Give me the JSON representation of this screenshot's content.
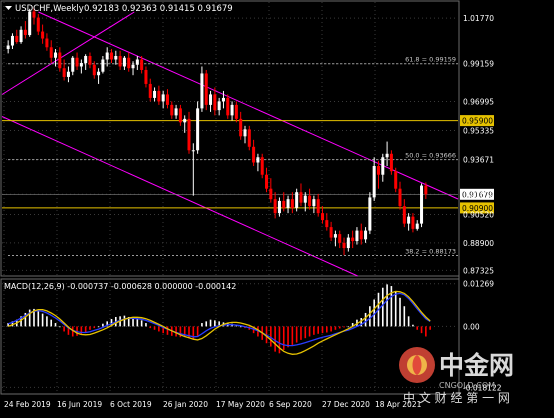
{
  "header": {
    "symbol": "USDCHF,Weekly",
    "ohlc": "0.92183 0.92363 0.91415 0.91679"
  },
  "colors": {
    "background": "#000000",
    "grid": "#3a3a3a",
    "bull": "#ffffff",
    "bear": "#ff0000",
    "channel": "#ff00ff",
    "level_line": "#e6c200",
    "fib_line": "#9a9a9a",
    "macd_line": "#e6c200",
    "signal_line": "#2a3cff",
    "hist_pos": "#ffffff",
    "hist_neg": "#ff0000"
  },
  "price_axis": {
    "labels": [
      "1.01770",
      "0.99159",
      "0.96995",
      "0.95335",
      "0.93671",
      "0.91679",
      "0.90520",
      "0.88900",
      "0.87325"
    ],
    "ylim": [
      0.87,
      1.0275
    ]
  },
  "levels": [
    {
      "name": "level-0.95900",
      "value": 0.959,
      "label": "0.95900",
      "type": "horizontal"
    },
    {
      "name": "level-0.90900",
      "value": 0.909,
      "label": "0.90900",
      "type": "horizontal"
    },
    {
      "name": "current-price",
      "value": 0.91679,
      "label": "0.91679",
      "type": "price"
    }
  ],
  "fib": [
    {
      "label": "61.8 = 0.99159",
      "value": 0.99159
    },
    {
      "label": "50.0 = 0.93666",
      "value": 0.93666
    },
    {
      "label": "38.2 = 0.88173",
      "value": 0.88173
    }
  ],
  "time_axis": {
    "labels": [
      "24 Feb 2019",
      "16 Jun 2019",
      "6 Oct 2019",
      "26 Jan 2020",
      "17 May 2020",
      "6 Sep 2020",
      "27 Dec 2020",
      "18 Apr 2021"
    ]
  },
  "macd": {
    "title": "MACD(12,26,9) -0.000737 -0.000628 0.000000 -0.000142",
    "labels": [
      "0.01269",
      "0.00",
      "-0.018122"
    ],
    "ylim": [
      -0.0195,
      0.0135
    ]
  },
  "chart_data": {
    "type": "candlestick",
    "title": "USDCHF,Weekly",
    "candles": [
      [
        1.0,
        1.005,
        0.9975,
        1.002
      ],
      [
        1.002,
        1.009,
        1.0,
        1.0075
      ],
      [
        1.0075,
        1.011,
        1.003,
        1.004
      ],
      [
        1.004,
        1.013,
        1.003,
        1.011
      ],
      [
        1.011,
        1.016,
        1.006,
        1.008
      ],
      [
        1.008,
        1.023,
        1.007,
        1.0215
      ],
      [
        1.0215,
        1.024,
        1.014,
        1.018
      ],
      [
        1.018,
        1.02,
        1.008,
        1.01
      ],
      [
        1.01,
        1.014,
        1.003,
        1.006
      ],
      [
        1.006,
        1.009,
        0.999,
        1.001
      ],
      [
        1.001,
        1.005,
        0.992,
        0.995
      ],
      [
        0.995,
        1.0,
        0.99,
        0.998
      ],
      [
        0.998,
        1.001,
        0.987,
        0.989
      ],
      [
        0.989,
        0.994,
        0.982,
        0.984
      ],
      [
        0.984,
        0.99,
        0.981,
        0.987
      ],
      [
        0.987,
        0.996,
        0.985,
        0.995
      ],
      [
        0.995,
        0.998,
        0.988,
        0.99
      ],
      [
        0.99,
        0.994,
        0.986,
        0.992
      ],
      [
        0.992,
        0.997,
        0.988,
        0.996
      ],
      [
        0.996,
        0.998,
        0.989,
        0.991
      ],
      [
        0.991,
        0.993,
        0.983,
        0.985
      ],
      [
        0.985,
        0.989,
        0.98,
        0.987
      ],
      [
        0.987,
        0.996,
        0.986,
        0.994
      ],
      [
        0.994,
        1.001,
        0.99,
        0.998
      ],
      [
        0.998,
        1.0,
        0.992,
        0.994
      ],
      [
        0.994,
        0.999,
        0.991,
        0.996
      ],
      [
        0.996,
        0.999,
        0.988,
        0.99
      ],
      [
        0.99,
        0.996,
        0.988,
        0.995
      ],
      [
        0.995,
        0.998,
        0.987,
        0.989
      ],
      [
        0.989,
        0.993,
        0.985,
        0.991
      ],
      [
        0.991,
        0.996,
        0.988,
        0.994
      ],
      [
        0.994,
        0.996,
        0.986,
        0.988
      ],
      [
        0.988,
        0.99,
        0.978,
        0.98
      ],
      [
        0.98,
        0.983,
        0.97,
        0.972
      ],
      [
        0.972,
        0.978,
        0.97,
        0.976
      ],
      [
        0.976,
        0.979,
        0.968,
        0.97
      ],
      [
        0.97,
        0.976,
        0.966,
        0.974
      ],
      [
        0.974,
        0.977,
        0.966,
        0.968
      ],
      [
        0.968,
        0.97,
        0.96,
        0.962
      ],
      [
        0.962,
        0.968,
        0.96,
        0.966
      ],
      [
        0.966,
        0.968,
        0.956,
        0.958
      ],
      [
        0.958,
        0.962,
        0.952,
        0.96
      ],
      [
        0.96,
        0.964,
        0.94,
        0.942
      ],
      [
        0.942,
        0.946,
        0.916,
        0.942
      ],
      [
        0.942,
        0.97,
        0.94,
        0.966
      ],
      [
        0.966,
        0.99,
        0.964,
        0.986
      ],
      [
        0.986,
        0.988,
        0.965,
        0.968
      ],
      [
        0.968,
        0.976,
        0.964,
        0.974
      ],
      [
        0.974,
        0.978,
        0.962,
        0.965
      ],
      [
        0.965,
        0.972,
        0.962,
        0.97
      ],
      [
        0.97,
        0.976,
        0.966,
        0.972
      ],
      [
        0.972,
        0.974,
        0.96,
        0.962
      ],
      [
        0.962,
        0.97,
        0.959,
        0.968
      ],
      [
        0.968,
        0.97,
        0.958,
        0.96
      ],
      [
        0.96,
        0.964,
        0.948,
        0.95
      ],
      [
        0.95,
        0.956,
        0.946,
        0.954
      ],
      [
        0.954,
        0.956,
        0.942,
        0.944
      ],
      [
        0.944,
        0.948,
        0.933,
        0.935
      ],
      [
        0.935,
        0.94,
        0.93,
        0.938
      ],
      [
        0.938,
        0.94,
        0.926,
        0.928
      ],
      [
        0.928,
        0.932,
        0.918,
        0.92
      ],
      [
        0.92,
        0.926,
        0.912,
        0.914
      ],
      [
        0.914,
        0.918,
        0.903,
        0.906
      ],
      [
        0.906,
        0.915,
        0.904,
        0.913
      ],
      [
        0.913,
        0.918,
        0.907,
        0.909
      ],
      [
        0.909,
        0.916,
        0.906,
        0.914
      ],
      [
        0.914,
        0.918,
        0.906,
        0.909
      ],
      [
        0.909,
        0.92,
        0.907,
        0.918
      ],
      [
        0.918,
        0.923,
        0.91,
        0.912
      ],
      [
        0.912,
        0.918,
        0.907,
        0.916
      ],
      [
        0.916,
        0.92,
        0.908,
        0.91
      ],
      [
        0.91,
        0.916,
        0.906,
        0.914
      ],
      [
        0.914,
        0.917,
        0.904,
        0.906
      ],
      [
        0.906,
        0.91,
        0.9,
        0.902
      ],
      [
        0.902,
        0.906,
        0.896,
        0.898
      ],
      [
        0.898,
        0.901,
        0.89,
        0.892
      ],
      [
        0.892,
        0.896,
        0.887,
        0.894
      ],
      [
        0.894,
        0.896,
        0.886,
        0.889
      ],
      [
        0.889,
        0.892,
        0.882,
        0.886
      ],
      [
        0.886,
        0.894,
        0.884,
        0.892
      ],
      [
        0.892,
        0.896,
        0.886,
        0.89
      ],
      [
        0.89,
        0.898,
        0.888,
        0.896
      ],
      [
        0.896,
        0.9,
        0.888,
        0.891
      ],
      [
        0.891,
        0.898,
        0.889,
        0.896
      ],
      [
        0.896,
        0.918,
        0.894,
        0.915
      ],
      [
        0.915,
        0.938,
        0.913,
        0.933
      ],
      [
        0.933,
        0.936,
        0.92,
        0.928
      ],
      [
        0.928,
        0.94,
        0.924,
        0.938
      ],
      [
        0.938,
        0.947,
        0.933,
        0.94
      ],
      [
        0.94,
        0.942,
        0.928,
        0.93
      ],
      [
        0.93,
        0.932,
        0.918,
        0.92
      ],
      [
        0.92,
        0.924,
        0.908,
        0.91
      ],
      [
        0.91,
        0.914,
        0.898,
        0.9
      ],
      [
        0.9,
        0.906,
        0.896,
        0.904
      ],
      [
        0.904,
        0.906,
        0.895,
        0.897
      ],
      [
        0.897,
        0.902,
        0.896,
        0.9
      ],
      [
        0.9,
        0.923,
        0.898,
        0.9218
      ],
      [
        0.9218,
        0.9236,
        0.9141,
        0.9168
      ]
    ],
    "macd_hist": [
      0.001,
      0.0015,
      0.002,
      0.003,
      0.004,
      0.005,
      0.0052,
      0.0045,
      0.0038,
      0.003,
      0.002,
      0.001,
      0.0,
      -0.0015,
      -0.0025,
      -0.003,
      -0.0028,
      -0.0025,
      -0.0018,
      -0.001,
      -0.0005,
      0.0,
      0.0008,
      0.0015,
      0.0022,
      0.0028,
      0.003,
      0.0032,
      0.0028,
      0.0025,
      0.0022,
      0.0018,
      0.001,
      -0.0005,
      -0.001,
      -0.0015,
      -0.002,
      -0.0025,
      -0.0028,
      -0.003,
      -0.0032,
      -0.003,
      -0.0035,
      -0.0038,
      -0.0028,
      0.001,
      0.0015,
      0.002,
      0.0018,
      0.0015,
      0.0012,
      0.001,
      0.0008,
      0.0005,
      0.0,
      -0.0005,
      -0.001,
      -0.002,
      -0.003,
      -0.004,
      -0.005,
      -0.006,
      -0.0075,
      -0.008,
      -0.007,
      -0.0062,
      -0.0055,
      -0.0048,
      -0.004,
      -0.0035,
      -0.003,
      -0.0025,
      -0.0022,
      -0.002,
      -0.0018,
      -0.0015,
      -0.001,
      -0.0006,
      -0.0003,
      0.0,
      0.001,
      0.002,
      0.0025,
      0.004,
      0.006,
      0.008,
      0.01,
      0.0115,
      0.0125,
      0.012,
      0.0105,
      0.0085,
      0.006,
      0.003,
      0.0005,
      -0.001,
      -0.002,
      -0.003,
      -0.001
    ],
    "macd_signal": [
      0.0008,
      0.0012,
      0.0018,
      0.0025,
      0.0032,
      0.004,
      0.0045,
      0.0047,
      0.0045,
      0.004,
      0.0033,
      0.0025,
      0.0016,
      0.0006,
      -0.0004,
      -0.0012,
      -0.0016,
      -0.0018,
      -0.0018,
      -0.0016,
      -0.0012,
      -0.0008,
      -0.0003,
      0.0003,
      0.0008,
      0.0013,
      0.0018,
      0.0022,
      0.0024,
      0.0024,
      0.0023,
      0.0021,
      0.0018,
      0.0013,
      0.0008,
      0.0003,
      -0.0003,
      -0.0008,
      -0.0013,
      -0.0018,
      -0.0022,
      -0.0025,
      -0.0028,
      -0.0031,
      -0.003,
      -0.0022,
      -0.0013,
      -0.0006,
      -0.0001,
      0.0002,
      0.0004,
      0.0005,
      0.0005,
      0.0004,
      0.0002,
      -0.0001,
      -0.0004,
      -0.0008,
      -0.0013,
      -0.0019,
      -0.0026,
      -0.0033,
      -0.0042,
      -0.005,
      -0.0055,
      -0.0057,
      -0.0057,
      -0.0055,
      -0.0052,
      -0.0048,
      -0.0044,
      -0.004,
      -0.0036,
      -0.0032,
      -0.0029,
      -0.0026,
      -0.0022,
      -0.0018,
      -0.0014,
      -0.0011,
      -0.0006,
      0.0,
      0.0006,
      0.0014,
      0.0024,
      0.0036,
      0.005,
      0.0064,
      0.0078,
      0.0089,
      0.0096,
      0.0098,
      0.0094,
      0.0083,
      0.0068,
      0.0052,
      0.0037,
      0.0023,
      0.0015
    ],
    "macd_line": [
      0.0,
      0.0005,
      0.001,
      0.0018,
      0.0028,
      0.0038,
      0.0046,
      0.005,
      0.005,
      0.0046,
      0.004,
      0.0032,
      0.0022,
      0.001,
      -0.0002,
      -0.0012,
      -0.002,
      -0.0024,
      -0.0025,
      -0.0024,
      -0.002,
      -0.0015,
      -0.001,
      -0.0004,
      0.0003,
      0.001,
      0.0016,
      0.0021,
      0.0025,
      0.0027,
      0.0027,
      0.0026,
      0.0023,
      0.0018,
      0.0012,
      0.0006,
      0.0,
      -0.0007,
      -0.0013,
      -0.0019,
      -0.0025,
      -0.003,
      -0.0034,
      -0.0038,
      -0.004,
      -0.0036,
      -0.0028,
      -0.0018,
      -0.0008,
      0.0,
      0.0006,
      0.001,
      0.0012,
      0.0012,
      0.001,
      0.0007,
      0.0003,
      -0.0003,
      -0.001,
      -0.0019,
      -0.0029,
      -0.004,
      -0.0052,
      -0.0064,
      -0.0074,
      -0.008,
      -0.0083,
      -0.0082,
      -0.0078,
      -0.0072,
      -0.0065,
      -0.0058,
      -0.005,
      -0.0043,
      -0.0037,
      -0.0031,
      -0.0025,
      -0.0019,
      -0.0013,
      -0.0007,
      0.0,
      0.0008,
      0.0016,
      0.0026,
      0.0038,
      0.0052,
      0.0066,
      0.008,
      0.0092,
      0.01,
      0.0104,
      0.0103,
      0.0098,
      0.0088,
      0.0074,
      0.0058,
      0.0042,
      0.0028,
      0.0016
    ]
  },
  "watermark": {
    "brand": "中金网",
    "domain": "CNGOLD.COM",
    "slogan": "中 文 财 经 第 一 网"
  }
}
